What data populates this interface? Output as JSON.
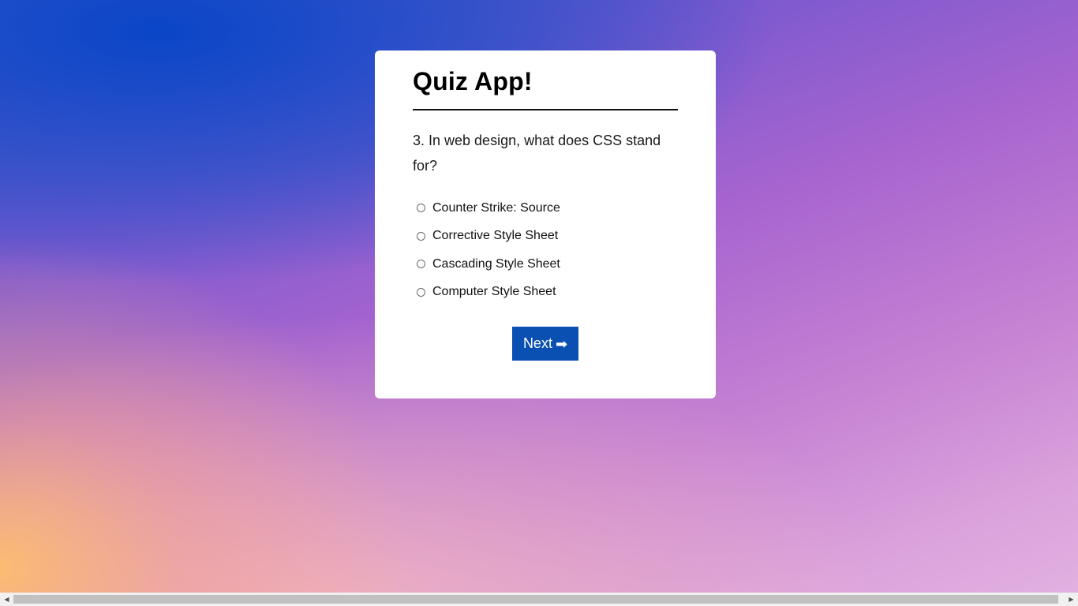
{
  "quiz": {
    "title": "Quiz App!",
    "question": "3. In web design, what does CSS stand for?",
    "options": [
      {
        "label": "Counter Strike: Source"
      },
      {
        "label": "Corrective Style Sheet"
      },
      {
        "label": "Cascading Style Sheet"
      },
      {
        "label": "Computer Style Sheet"
      }
    ],
    "next_label": "Next",
    "next_icon": "right-arrow-icon",
    "next_arrow_glyph": "➡"
  },
  "colors": {
    "button_bg": "#0a4fb2",
    "card_bg": "#ffffff"
  },
  "scrollbar": {
    "left_arrow_glyph": "◀",
    "right_arrow_glyph": "▶"
  }
}
